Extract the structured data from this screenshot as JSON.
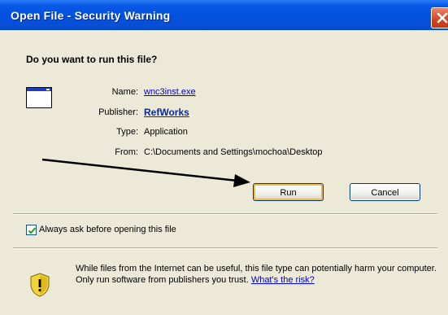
{
  "window": {
    "title": "Open File - Security Warning"
  },
  "dialog": {
    "heading": "Do you want to run this file?",
    "labels": {
      "name": "Name:",
      "publisher": "Publisher:",
      "type": "Type:",
      "from": "From:"
    },
    "values": {
      "name": "wnc3inst.exe",
      "publisher": "RefWorks",
      "type": "Application",
      "from": "C:\\Documents and Settings\\mochoa\\Desktop"
    },
    "buttons": {
      "run": "Run",
      "cancel": "Cancel"
    },
    "checkbox": {
      "label": "Always ask before opening this file",
      "checked": true
    },
    "warning": {
      "text": "While files from the Internet can be useful, this file type can potentially harm your computer. Only run software from publishers you trust. ",
      "link": "What's the risk?"
    }
  },
  "colors": {
    "titlebar": "#0050dd",
    "dialog_bg": "#ece9d8",
    "link": "#0000cc",
    "default_button_highlight": "#f2b84e"
  }
}
